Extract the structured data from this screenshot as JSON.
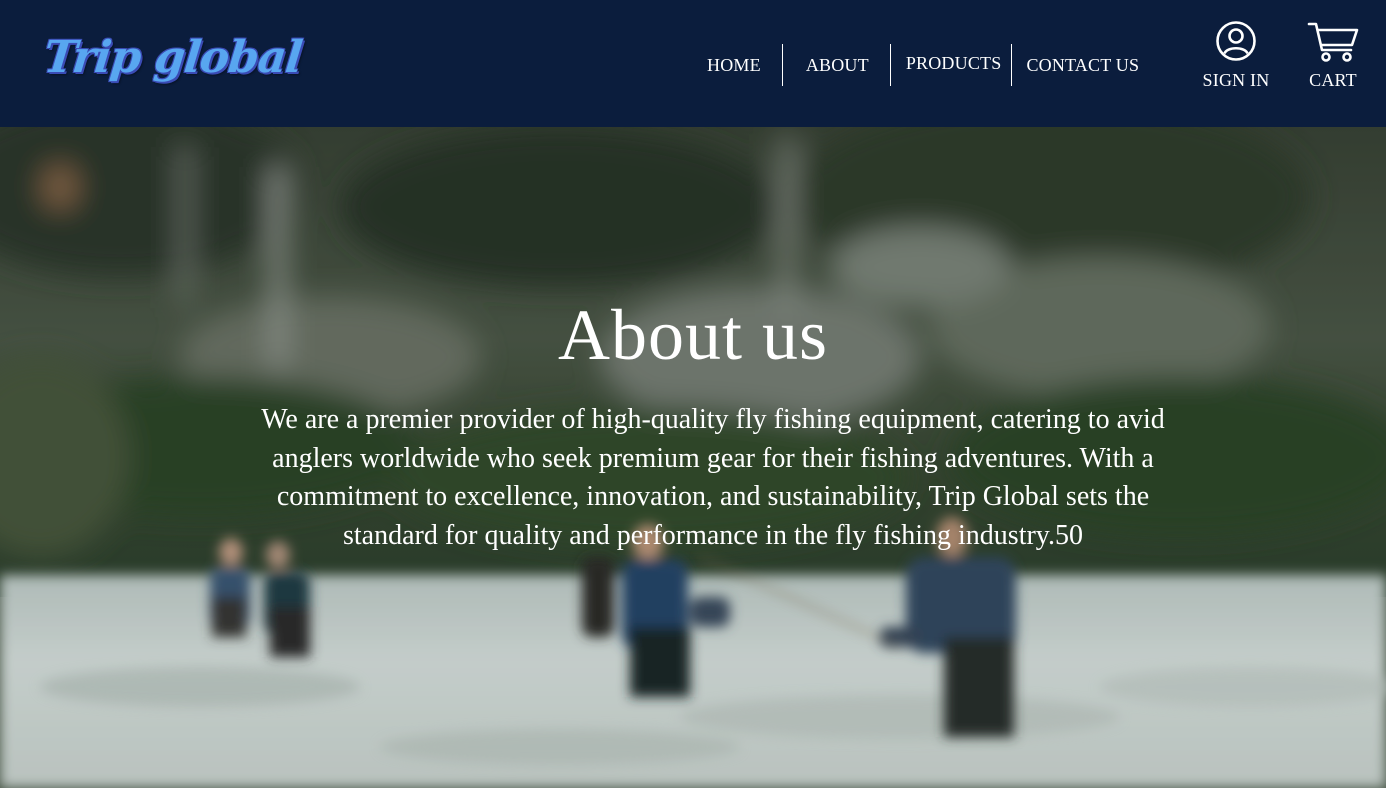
{
  "header": {
    "logo_text": "Trip global",
    "nav": [
      {
        "label": "HOME"
      },
      {
        "label": "ABOUT"
      },
      {
        "label": "PRODUCTS"
      },
      {
        "label": "CONTACT US"
      }
    ],
    "signin_label": "SIGN IN",
    "cart_label": "CART",
    "signin_icon": "user-circle-icon",
    "cart_icon": "shopping-cart-icon"
  },
  "hero": {
    "title": "About us",
    "description": "We are a premier provider of high-quality fly fishing equipment, catering to avid anglers worldwide who seek premium gear for their fishing adventures. With a commitment to excellence, innovation, and sustainability, Trip Global sets the standard for quality and performance in the fly fishing industry.50",
    "background_image": "blurred-anglers-fly-fishing-in-river"
  },
  "colors": {
    "header_bg": "#0b1d3d",
    "logo": "#58a6f0",
    "logo_outline": "#3a4bb5",
    "text": "#ffffff"
  }
}
